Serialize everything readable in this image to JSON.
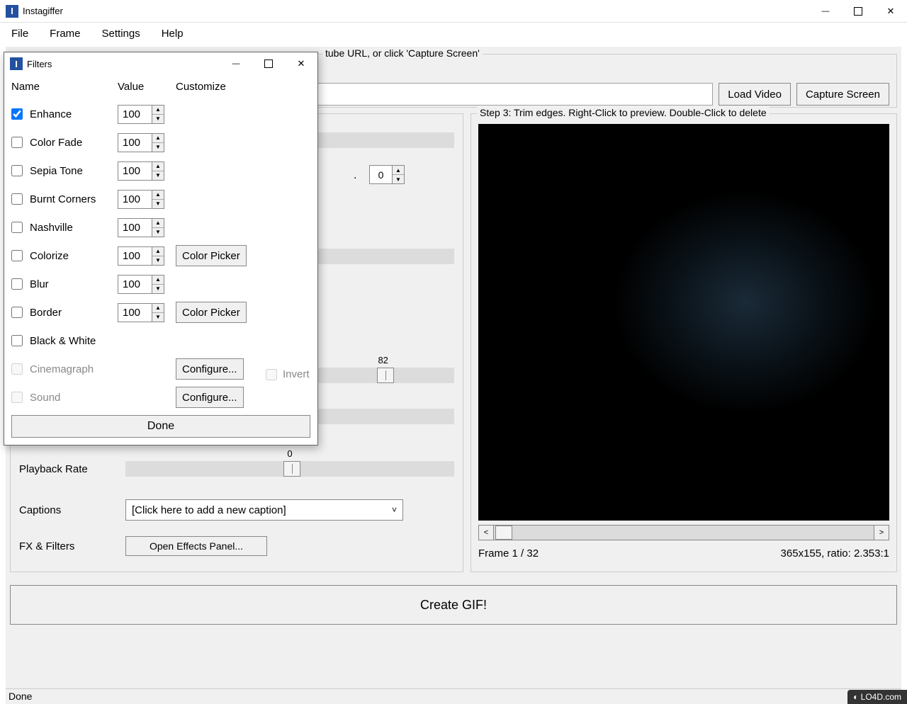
{
  "app": {
    "title": "Instagiffer",
    "icon_text": "I"
  },
  "menu": {
    "file": "File",
    "frame": "Frame",
    "settings": "Settings",
    "help": "Help"
  },
  "step1": {
    "legend_partial": "tube URL, or click 'Capture Screen'",
    "load_video": "Load Video",
    "capture_screen": "Capture Screen"
  },
  "step2": {
    "small_spinner_value": "0",
    "small_spinner_sep": ".",
    "slider1_value": "82",
    "playback_rate_label": "Playback Rate",
    "playback_rate_value": "0",
    "captions_label": "Captions",
    "captions_placeholder": "[Click here to add a new caption]",
    "fx_label": "FX & Filters",
    "fx_button": "Open Effects Panel..."
  },
  "step3": {
    "legend": "Step 3: Trim edges. Right-Click to preview. Double-Click to delete",
    "scroll_left": "<",
    "scroll_right": ">",
    "frame_info": "Frame  1 / 32",
    "ratio_info": "365x155, ratio: 2.353:1"
  },
  "create_gif": "Create GIF!",
  "status": "Done",
  "watermark": "◐ LO4D.com",
  "filters_dialog": {
    "title": "Filters",
    "icon_text": "I",
    "headers": {
      "name": "Name",
      "value": "Value",
      "customize": "Customize"
    },
    "rows": [
      {
        "checked": true,
        "label": "Enhance",
        "value": "100",
        "btn": null,
        "disabled": false
      },
      {
        "checked": false,
        "label": "Color Fade",
        "value": "100",
        "btn": null,
        "disabled": false
      },
      {
        "checked": false,
        "label": "Sepia Tone",
        "value": "100",
        "btn": null,
        "disabled": false
      },
      {
        "checked": false,
        "label": "Burnt Corners",
        "value": "100",
        "btn": null,
        "disabled": false
      },
      {
        "checked": false,
        "label": "Nashville",
        "value": "100",
        "btn": null,
        "disabled": false
      },
      {
        "checked": false,
        "label": "Colorize",
        "value": "100",
        "btn": "Color Picker",
        "disabled": false
      },
      {
        "checked": false,
        "label": "Blur",
        "value": "100",
        "btn": null,
        "disabled": false
      },
      {
        "checked": false,
        "label": "Border",
        "value": "100",
        "btn": "Color Picker",
        "disabled": false
      },
      {
        "checked": false,
        "label": "Black & White",
        "value": null,
        "btn": null,
        "disabled": false
      },
      {
        "checked": false,
        "label": "Cinemagraph",
        "value": null,
        "btn": "Configure...",
        "disabled": true
      },
      {
        "checked": false,
        "label": "Sound",
        "value": null,
        "btn": "Configure...",
        "disabled": true
      }
    ],
    "invert_label": "Invert",
    "done": "Done"
  }
}
